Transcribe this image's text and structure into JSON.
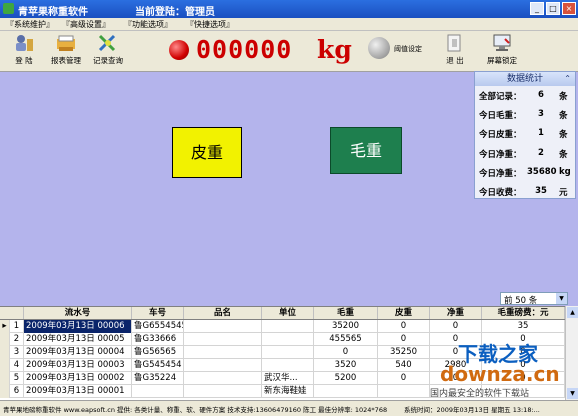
{
  "window": {
    "title": "青苹果称重软件",
    "login_label": "当前登陆：管理员",
    "buttons": [
      "_",
      "□",
      "×"
    ]
  },
  "menu": [
    {
      "label": "『系统维护』"
    },
    {
      "label": "『高级设置』"
    },
    {
      "label": "『功能选项』"
    },
    {
      "label": "『快捷选项』"
    }
  ],
  "toolbar": {
    "login": "登 陆",
    "report": "报表管理",
    "records": "记录查询",
    "threshold": "阈值设定",
    "exit": "退 出",
    "lock": "屏幕锁定"
  },
  "weight": {
    "value": "000000",
    "unit": "kg"
  },
  "main": {
    "tare_button": "皮重",
    "gross_button": "毛重"
  },
  "stats": {
    "title": "数据统计",
    "collapse_glyph": "⌃",
    "rows": [
      {
        "label": "全部记录：",
        "value": "6",
        "unit": "条"
      },
      {
        "label": "今日毛重：",
        "value": "3",
        "unit": "条"
      },
      {
        "label": "今日皮重：",
        "value": "1",
        "unit": "条"
      },
      {
        "label": "今日净重：",
        "value": "2",
        "unit": "条"
      },
      {
        "label": "今日净重：",
        "value": "35680",
        "unit": "kg"
      },
      {
        "label": "今日收费：",
        "value": "35",
        "unit": "元"
      }
    ]
  },
  "limit_select": {
    "value": "前 50 条"
  },
  "table": {
    "columns": [
      "流水号",
      "车号",
      "品名",
      "单位",
      "毛重",
      "皮重",
      "净重",
      "毛重磅费：元"
    ],
    "rows": [
      {
        "idx": "1",
        "marker": "▸",
        "serial": "2009年03月13日 00006",
        "plate": "鲁G65545454",
        "product": "",
        "unit": "",
        "gross": "35200",
        "tare": "0",
        "net": "0",
        "fee": "35"
      },
      {
        "idx": "2",
        "marker": "",
        "serial": "2009年03月13日 00005",
        "plate": "鲁G33666",
        "product": "",
        "unit": "",
        "gross": "455565",
        "tare": "0",
        "net": "0",
        "fee": "0"
      },
      {
        "idx": "3",
        "marker": "",
        "serial": "2009年03月13日 00004",
        "plate": "鲁G56565",
        "product": "",
        "unit": "",
        "gross": "0",
        "tare": "35250",
        "net": "0",
        "fee": "0"
      },
      {
        "idx": "4",
        "marker": "",
        "serial": "2009年03月13日 00003",
        "plate": "鲁G545454",
        "product": "",
        "unit": "",
        "gross": "3520",
        "tare": "540",
        "net": "2980",
        "fee": "0"
      },
      {
        "idx": "5",
        "marker": "",
        "serial": "2009年03月13日 00002",
        "plate": "鲁G35224",
        "product": "",
        "unit": "武汉华...",
        "gross": "5200",
        "tare": "0",
        "net": "0",
        "fee": "0"
      },
      {
        "idx": "6",
        "marker": "",
        "serial": "2009年03月13日 00001",
        "plate": "",
        "product": "",
        "unit": "新东海鞋娃",
        "gross": "",
        "tare": "",
        "net": "",
        "fee": ""
      }
    ]
  },
  "status": {
    "left": "青苹果地磅称重软件 www.eapsoft.cn  提供: 各类计量、称重、软、硬件方案  技术支持:13606479160 陈工  最佳分辨率: 1024*768",
    "right": "系统时间：2009年03月13日 星期五 13:18:..."
  },
  "watermark": {
    "line1": "下载之家",
    "line2": "downza.cn",
    "line3": "国内最安全的软件下载站"
  }
}
